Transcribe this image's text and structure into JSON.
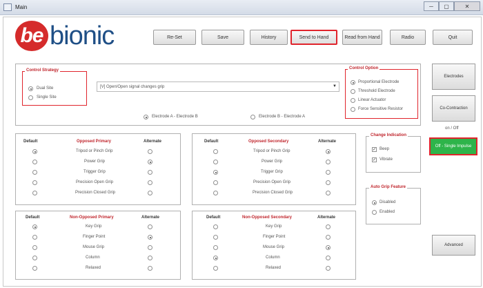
{
  "window": {
    "title": "Main",
    "btn_min": "─",
    "btn_max": "▢",
    "btn_close": "✕"
  },
  "logo": {
    "be": "be",
    "rest": "bionic"
  },
  "toolbar": {
    "reset": "Re-Set",
    "save": "Save",
    "history": "History",
    "send": "Send to Hand",
    "read": "Read from Hand",
    "radio": "Radio",
    "quit": "Quit"
  },
  "control_strategy": {
    "legend": "Control Strategy",
    "options": [
      "Dual Site",
      "Single Site"
    ],
    "selected": 0
  },
  "combo": {
    "value": "[V] Open/Open signal changes grip",
    "arrow": "▼"
  },
  "electrodes": {
    "a": "Electrode A - Electrode B",
    "b": "Electrode B - Electrode A",
    "selected": 0
  },
  "control_option": {
    "legend": "Control Option",
    "options": [
      "Proportional Electrode",
      "Threshold Electrode",
      "Linear Actuator",
      "Force Sensitive Resistor"
    ],
    "selected": 0
  },
  "side_buttons": {
    "electrodes": "Electrodes",
    "cocontraction": "Co-Contraction",
    "on_off": "on / Off",
    "single_impulse": "Off - Single Impulse",
    "advanced": "Advanced"
  },
  "opposed_primary": {
    "col_default": "Default",
    "col_title": "Opposed Primary",
    "col_alternate": "Alternate",
    "rows": [
      "Tripod or Pinch Grip",
      "Power Grip",
      "Trigger Grip",
      "Precision Open Grip",
      "Precision Closed Grip"
    ],
    "default_sel": 0,
    "alt_sel": 1
  },
  "opposed_secondary": {
    "col_default": "Default",
    "col_title": "Opposed Secondary",
    "col_alternate": "Alternate",
    "rows": [
      "Tripod or Pinch Grip",
      "Power Grip",
      "Trigger Grip",
      "Precision Open Grip",
      "Precision Closed Grip"
    ],
    "default_sel": 2,
    "alt_sel": 0
  },
  "non_opposed_primary": {
    "col_default": "Default",
    "col_title": "Non-Opposed Primary",
    "col_alternate": "Alternate",
    "rows": [
      "Key Grip",
      "Finger Point",
      "Mouse Grip",
      "Column",
      "Relaxed"
    ],
    "default_sel": 0,
    "alt_sel": 1
  },
  "non_opposed_secondary": {
    "col_default": "Default",
    "col_title": "Non-Opposed Secondary",
    "col_alternate": "Alternate",
    "rows": [
      "Key Grip",
      "Finger Point",
      "Mouse Grip",
      "Column",
      "Relaxed"
    ],
    "default_sel": 3,
    "alt_sel": 2
  },
  "change_indication": {
    "legend": "Change Indication",
    "options": [
      "Beep",
      "Vibrate"
    ]
  },
  "auto_grip": {
    "legend": "Auto Grip Feature",
    "options": [
      "Disabled",
      "Enabled"
    ],
    "selected": 0
  },
  "colors": {
    "accent_red": "#e0232b",
    "green": "#2eb44a",
    "logo_blue": "#1f4f86"
  }
}
